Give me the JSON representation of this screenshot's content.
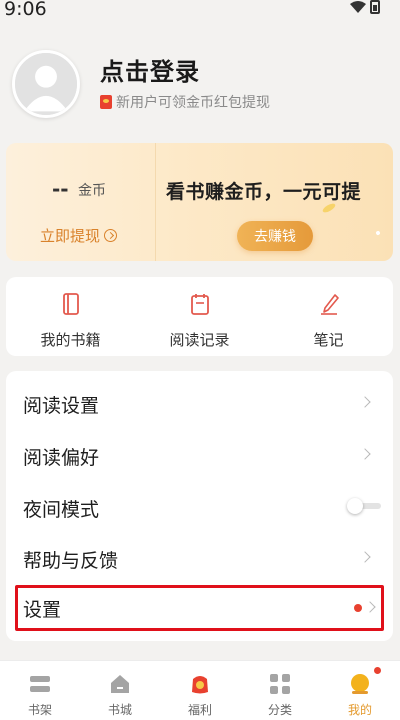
{
  "status_bar": {
    "time": "9:06"
  },
  "profile": {
    "login_title": "点击登录",
    "subtitle": "新用户可领金币红包提现"
  },
  "coin_card": {
    "coin_amount": "--",
    "coin_unit": "金币",
    "withdraw_label": "立即提现",
    "promo_title": "看书赚金币，一元可提",
    "earn_button": "去赚钱"
  },
  "quick_actions": [
    {
      "label": "我的书籍",
      "icon": "book-icon"
    },
    {
      "label": "阅读记录",
      "icon": "reading-record-icon"
    },
    {
      "label": "笔记",
      "icon": "pen-icon"
    }
  ],
  "menu": {
    "reading_settings": "阅读设置",
    "reading_preferences": "阅读偏好",
    "night_mode": "夜间模式",
    "night_mode_enabled": false,
    "help_feedback": "帮助与反馈",
    "settings": "设置"
  },
  "bottom_nav": [
    {
      "label": "书架",
      "icon": "bookshelf-icon"
    },
    {
      "label": "书城",
      "icon": "bookstore-icon"
    },
    {
      "label": "福利",
      "icon": "welfare-icon"
    },
    {
      "label": "分类",
      "icon": "category-icon"
    },
    {
      "label": "我的",
      "icon": "profile-icon",
      "active": true
    }
  ],
  "colors": {
    "accent": "#e49a2e",
    "highlight_border": "#e0101a",
    "badge_red": "#e8412f"
  }
}
